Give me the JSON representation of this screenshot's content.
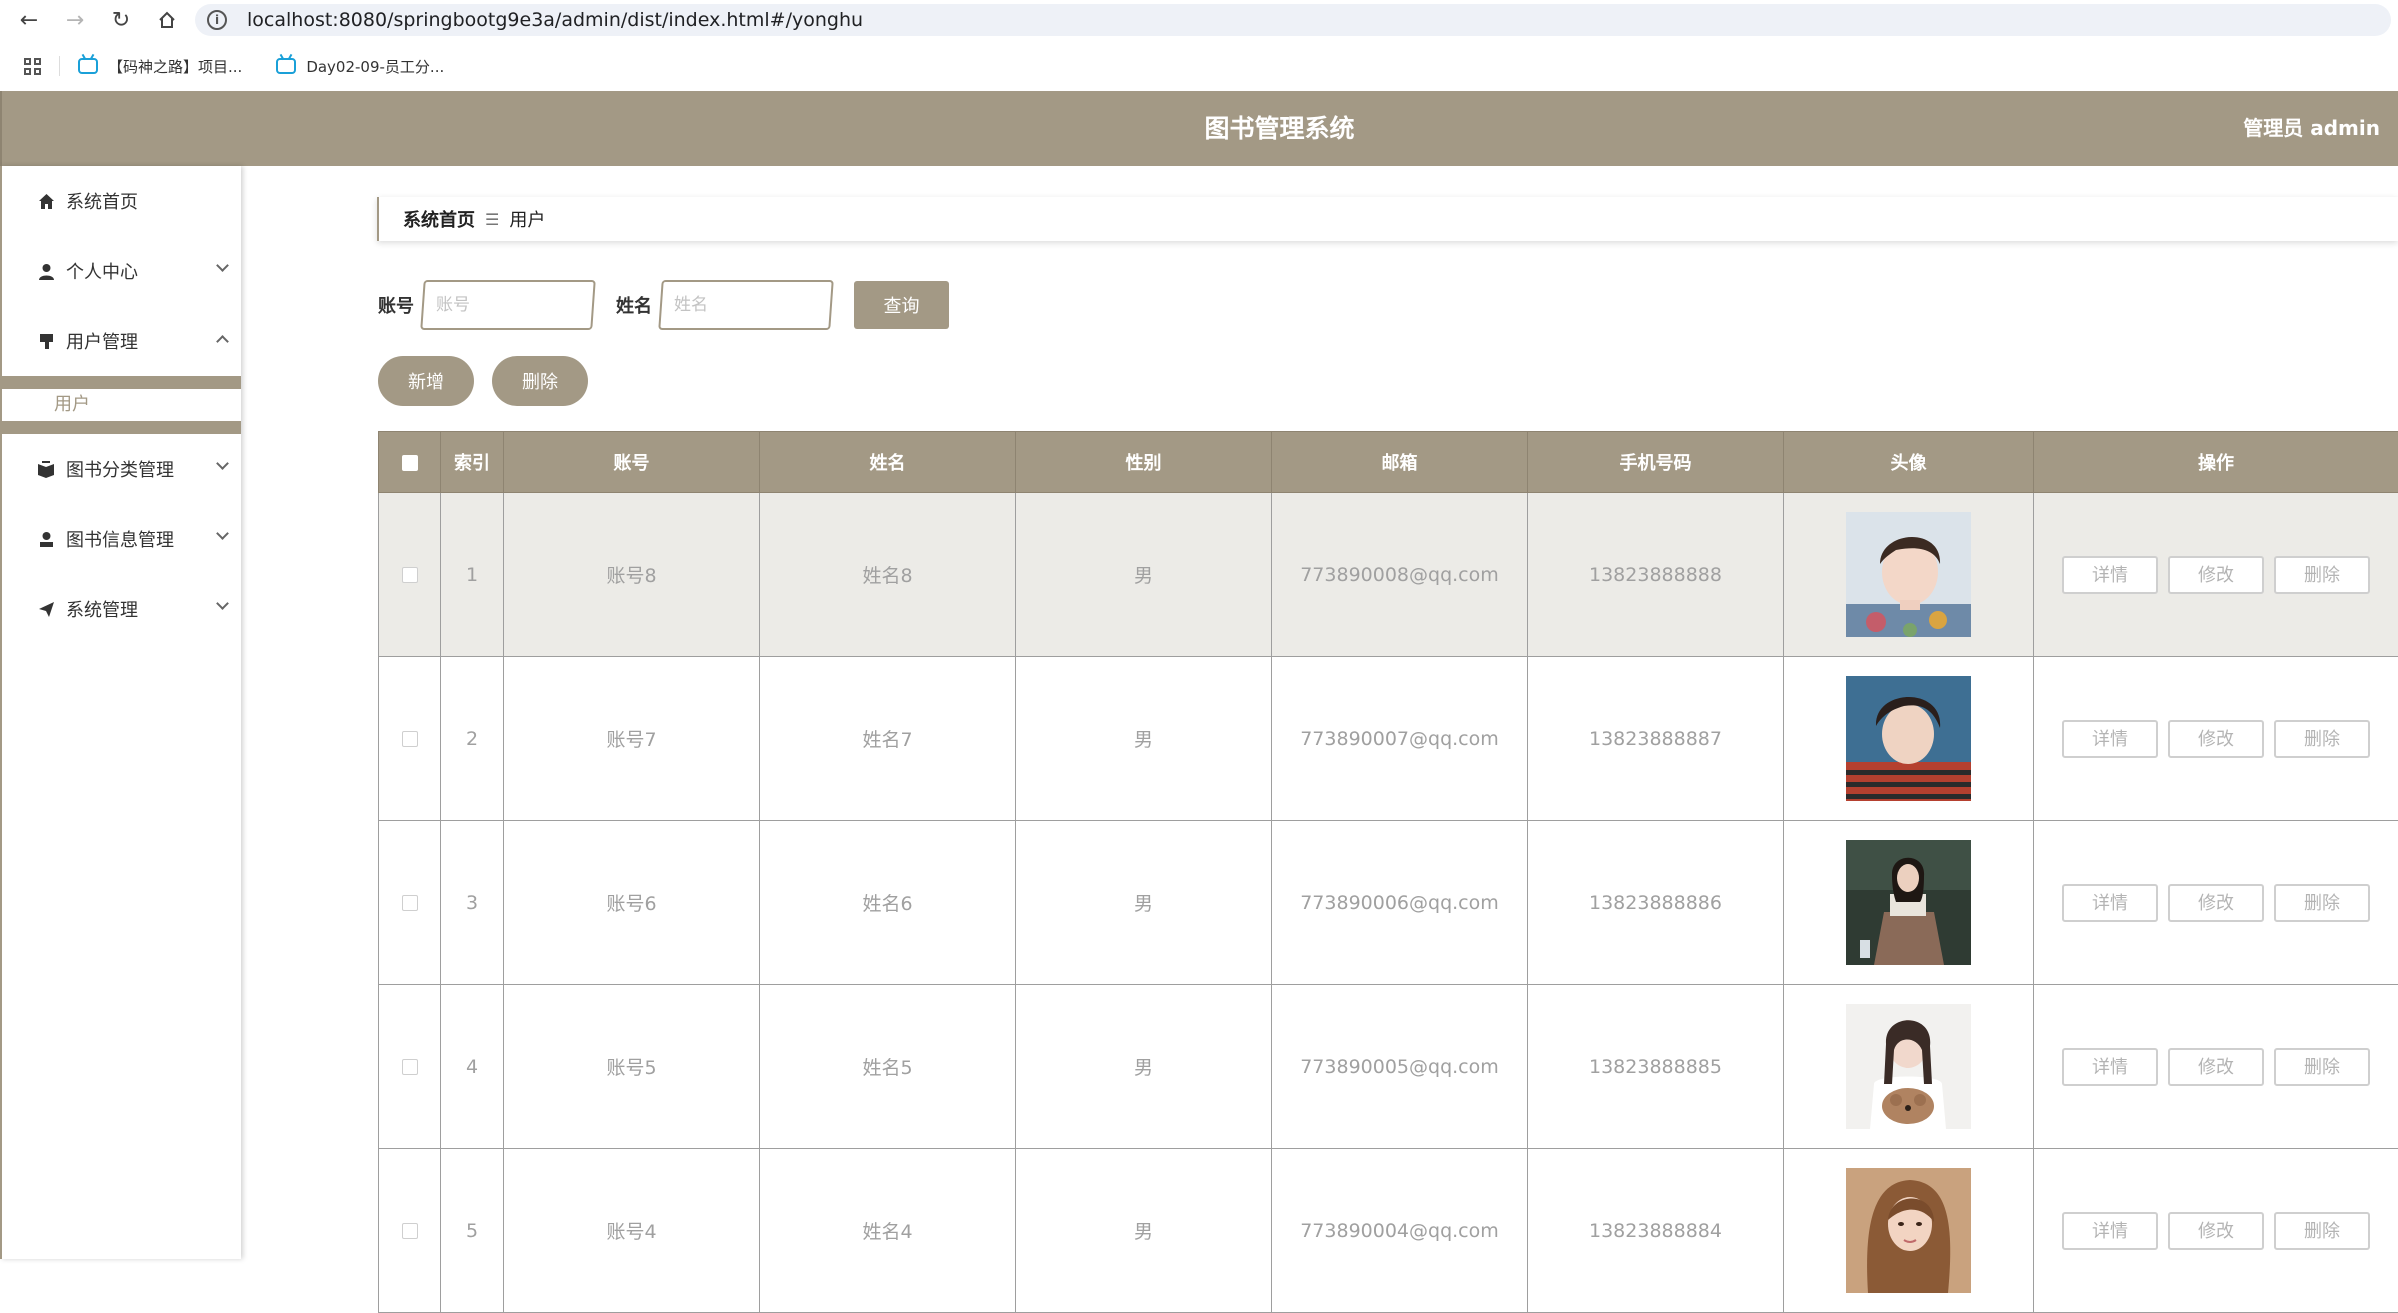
{
  "browser": {
    "url": "localhost:8080/springbootg9e3a/admin/dist/index.html#/yonghu",
    "bookmarks": [
      "【码神之路】项目...",
      "Day02-09-员工分..."
    ]
  },
  "header": {
    "title": "图书管理系统",
    "user": "管理员 admin"
  },
  "sidebar": {
    "items": [
      {
        "label": "系统首页",
        "icon": "home-icon"
      },
      {
        "label": "个人中心",
        "icon": "person-icon"
      },
      {
        "label": "用户管理",
        "icon": "user-manage-icon"
      },
      {
        "label": "图书分类管理",
        "icon": "category-icon"
      },
      {
        "label": "图书信息管理",
        "icon": "book-info-icon"
      },
      {
        "label": "系统管理",
        "icon": "send-icon"
      }
    ],
    "sub_item": "用户"
  },
  "breadcrumb": {
    "home": "系统首页",
    "separator": "☰",
    "current": "用户"
  },
  "search": {
    "account_label": "账号",
    "account_placeholder": "账号",
    "name_label": "姓名",
    "name_placeholder": "姓名",
    "query_button": "查询"
  },
  "actions": {
    "add": "新增",
    "delete": "删除"
  },
  "table": {
    "headers": [
      "索引",
      "账号",
      "姓名",
      "性别",
      "邮箱",
      "手机号码",
      "头像",
      "操作"
    ],
    "row_buttons": {
      "detail": "详情",
      "edit": "修改",
      "delete": "删除"
    },
    "rows": [
      {
        "index": "1",
        "account": "账号8",
        "name": "姓名8",
        "gender": "男",
        "email": "773890008@qq.com",
        "phone": "13823888888",
        "avatar": "avatar-boy-floral-shirt"
      },
      {
        "index": "2",
        "account": "账号7",
        "name": "姓名7",
        "gender": "男",
        "email": "773890007@qq.com",
        "phone": "13823888887",
        "avatar": "avatar-boy-striped-shirt"
      },
      {
        "index": "3",
        "account": "账号6",
        "name": "姓名6",
        "gender": "男",
        "email": "773890006@qq.com",
        "phone": "13823888886",
        "avatar": "avatar-girl-sitting"
      },
      {
        "index": "4",
        "account": "账号5",
        "name": "姓名5",
        "gender": "男",
        "email": "773890005@qq.com",
        "phone": "13823888885",
        "avatar": "avatar-girl-with-dog"
      },
      {
        "index": "5",
        "account": "账号4",
        "name": "姓名4",
        "gender": "男",
        "email": "773890004@qq.com",
        "phone": "13823888884",
        "avatar": "avatar-girl-long-hair"
      }
    ]
  },
  "colors": {
    "theme": "#a39985",
    "row_highlight": "#ecebe7"
  }
}
